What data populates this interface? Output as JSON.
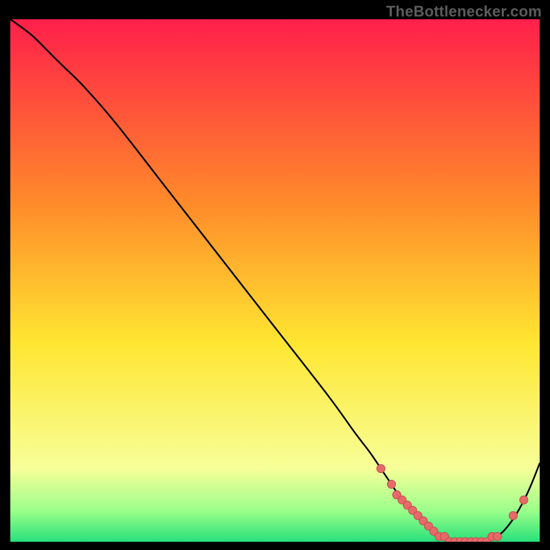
{
  "watermark": "TheBottlenecker.com",
  "colors": {
    "bg_black": "#000000",
    "grad_top": "#ff1f4a",
    "grad_mid1": "#ff8a2a",
    "grad_mid2": "#ffe631",
    "grad_low": "#f7ff99",
    "grad_bottom1": "#9cff8a",
    "grad_bottom2": "#28e07a",
    "curve": "#000000",
    "marker_fill": "#e66a6a",
    "marker_stroke": "#c24a4a"
  },
  "chart_data": {
    "type": "line",
    "title": "",
    "xlabel": "",
    "ylabel": "",
    "xlim": [
      0,
      100
    ],
    "ylim": [
      0,
      100
    ],
    "series": [
      {
        "name": "bottleneck-curve",
        "x": [
          0,
          4,
          8,
          10,
          14,
          20,
          30,
          40,
          50,
          60,
          65,
          68,
          70,
          72,
          74,
          76,
          78,
          80,
          82,
          84,
          86,
          88,
          90,
          92,
          94,
          96,
          98,
          100
        ],
        "y": [
          100,
          97,
          93,
          91,
          87,
          80,
          67,
          54,
          41,
          28,
          21,
          17,
          14,
          11,
          8,
          6,
          4,
          2,
          1,
          0,
          0,
          0,
          0,
          1,
          3,
          6,
          10,
          15
        ]
      }
    ],
    "markers": {
      "name": "highlight-points",
      "x": [
        70,
        72,
        73,
        74,
        75,
        76,
        77,
        78,
        79,
        80,
        81,
        82,
        83,
        84,
        85,
        86,
        87,
        88,
        89,
        90,
        91,
        92,
        95,
        97
      ],
      "y": [
        14,
        11,
        9,
        8,
        7,
        6,
        5,
        4,
        3,
        2,
        1,
        1,
        0,
        0,
        0,
        0,
        0,
        0,
        0,
        0,
        1,
        1,
        5,
        8
      ]
    }
  }
}
